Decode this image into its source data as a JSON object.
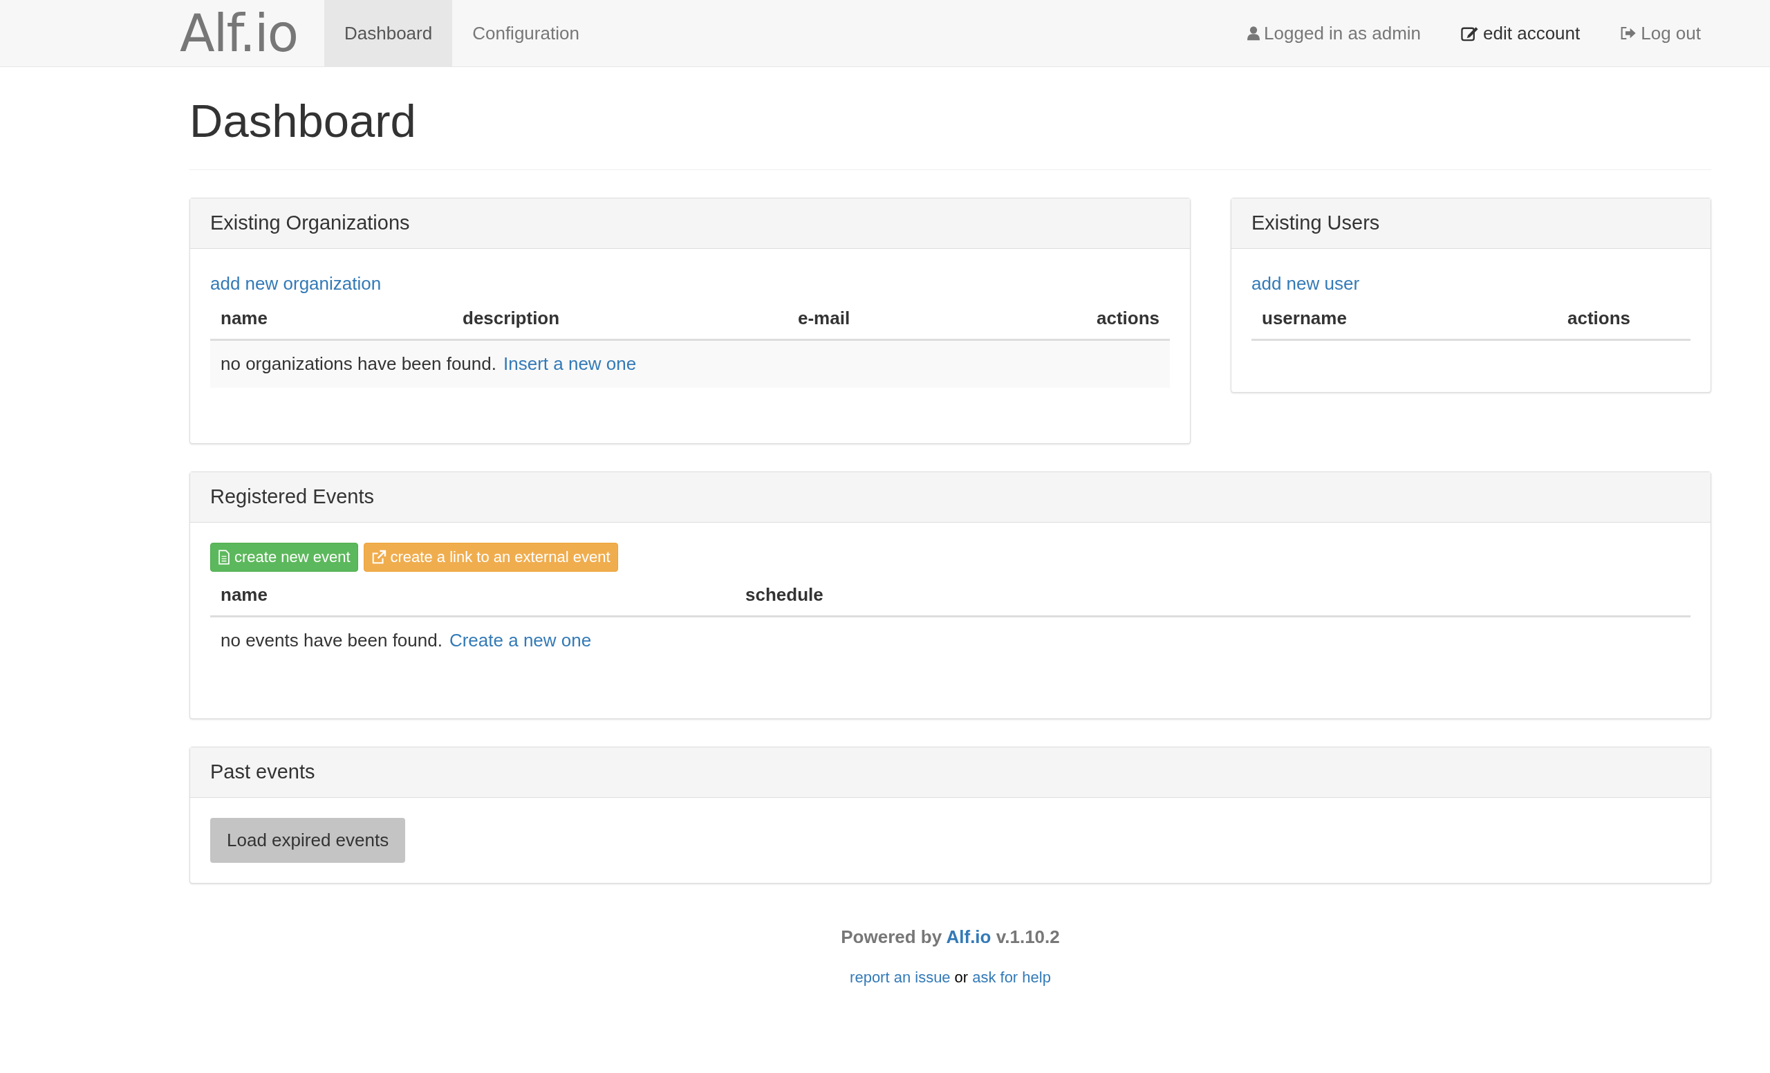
{
  "navbar": {
    "logo": "Alf.io",
    "tabs": [
      {
        "label": "Dashboard",
        "selected": true
      },
      {
        "label": "Configuration",
        "selected": false
      }
    ],
    "right": [
      {
        "kind": "user",
        "label": "Logged in as admin"
      },
      {
        "kind": "edit",
        "label": "edit account"
      },
      {
        "kind": "logout",
        "label": "Log out"
      }
    ]
  },
  "page_title": "Dashboard",
  "organizations": {
    "title": "Existing Organizations",
    "add_link": "add new organization",
    "columns": [
      "name",
      "description",
      "e-mail",
      "actions"
    ],
    "empty_text": "no organizations have been found.",
    "empty_link": "Insert a new one"
  },
  "users": {
    "title": "Existing Users",
    "add_link": "add new user",
    "columns": [
      "username",
      "actions"
    ]
  },
  "events": {
    "title": "Registered Events",
    "buttons": [
      {
        "kind": "create",
        "label": "create new event"
      },
      {
        "kind": "external",
        "label": "create a link to an external event"
      }
    ],
    "columns": [
      "name",
      "schedule"
    ],
    "empty_text": "no events have been found.",
    "empty_link": "Create a new one"
  },
  "past_events": {
    "title": "Past events",
    "button": "Load expired events"
  },
  "footer": {
    "powered_prefix": "Powered by",
    "powered_link": "Alf.io",
    "version": "v.1.10.2",
    "report_link": "report an issue",
    "or": "or",
    "help_link": "ask for help"
  }
}
